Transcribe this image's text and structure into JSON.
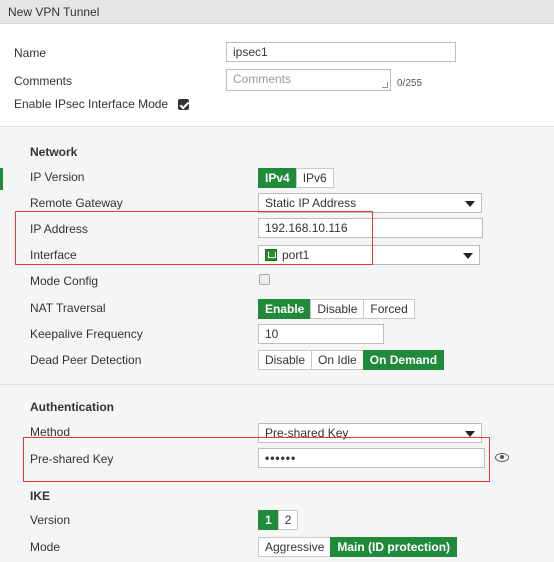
{
  "window": {
    "title": "New VPN Tunnel"
  },
  "general": {
    "name_label": "Name",
    "name_value": "ipsec1",
    "comments_label": "Comments",
    "comments_placeholder": "Comments",
    "comments_counter": "0/255",
    "enable_ipsec_label": "Enable IPsec Interface Mode",
    "enable_ipsec_checked": true
  },
  "network": {
    "heading": "Network",
    "ip_version_label": "IP Version",
    "ip_version_options": [
      "IPv4",
      "IPv6"
    ],
    "ip_version_selected": "IPv4",
    "remote_gateway_label": "Remote Gateway",
    "remote_gateway_value": "Static IP Address",
    "ip_address_label": "IP Address",
    "ip_address_value": "192.168.10.116",
    "interface_label": "Interface",
    "interface_value": "port1",
    "mode_config_label": "Mode Config",
    "mode_config_checked": false,
    "nat_traversal_label": "NAT Traversal",
    "nat_traversal_options": [
      "Enable",
      "Disable",
      "Forced"
    ],
    "nat_traversal_selected": "Enable",
    "keepalive_label": "Keepalive Frequency",
    "keepalive_value": "10",
    "dpd_label": "Dead Peer Detection",
    "dpd_options": [
      "Disable",
      "On Idle",
      "On Demand"
    ],
    "dpd_selected": "On Demand"
  },
  "authentication": {
    "heading": "Authentication",
    "method_label": "Method",
    "method_value": "Pre-shared Key",
    "psk_label": "Pre-shared Key",
    "psk_value": "••••••"
  },
  "ike": {
    "heading": "IKE",
    "version_label": "Version",
    "version_options": [
      "1",
      "2"
    ],
    "version_selected": "1",
    "mode_label": "Mode",
    "mode_options": [
      "Aggressive",
      "Main (ID protection)"
    ],
    "mode_selected": "Main (ID protection)"
  },
  "colors": {
    "accent_green": "#1f8a3a",
    "highlight_red": "#e53935",
    "section_bg": "#f5f5f5"
  }
}
